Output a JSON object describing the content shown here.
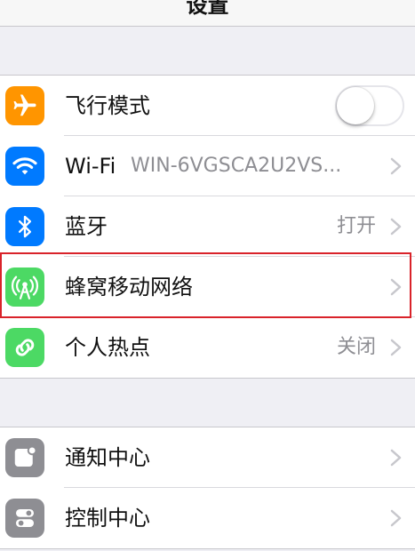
{
  "nav": {
    "title": "设置"
  },
  "network_group": {
    "airplane": {
      "label": "飞行模式",
      "toggle_on": false
    },
    "wifi": {
      "label": "Wi-Fi",
      "value": "WIN-6VGSCA2U2VS..."
    },
    "bluetooth": {
      "label": "蓝牙",
      "value": "打开"
    },
    "cellular": {
      "label": "蜂窝移动网络"
    },
    "hotspot": {
      "label": "个人热点",
      "value": "关闭"
    }
  },
  "system_group": {
    "notifications": {
      "label": "通知中心"
    },
    "control_center": {
      "label": "控制中心"
    }
  },
  "icons": {
    "airplane": "airplane-icon",
    "wifi": "wifi-icon",
    "bluetooth": "bluetooth-icon",
    "cellular": "cellular-antenna-icon",
    "hotspot": "hotspot-link-icon",
    "notifications": "notification-center-icon",
    "control_center": "control-center-icon",
    "chevron": "chevron-right-icon"
  },
  "colors": {
    "airplane": "#ff9500",
    "wifi": "#007aff",
    "bluetooth": "#007aff",
    "cellular": "#4cd964",
    "hotspot": "#4cd964",
    "notifications": "#8e8e93",
    "control_center": "#8e8e93",
    "highlight": "#d9232a",
    "background": "#efeff4"
  }
}
